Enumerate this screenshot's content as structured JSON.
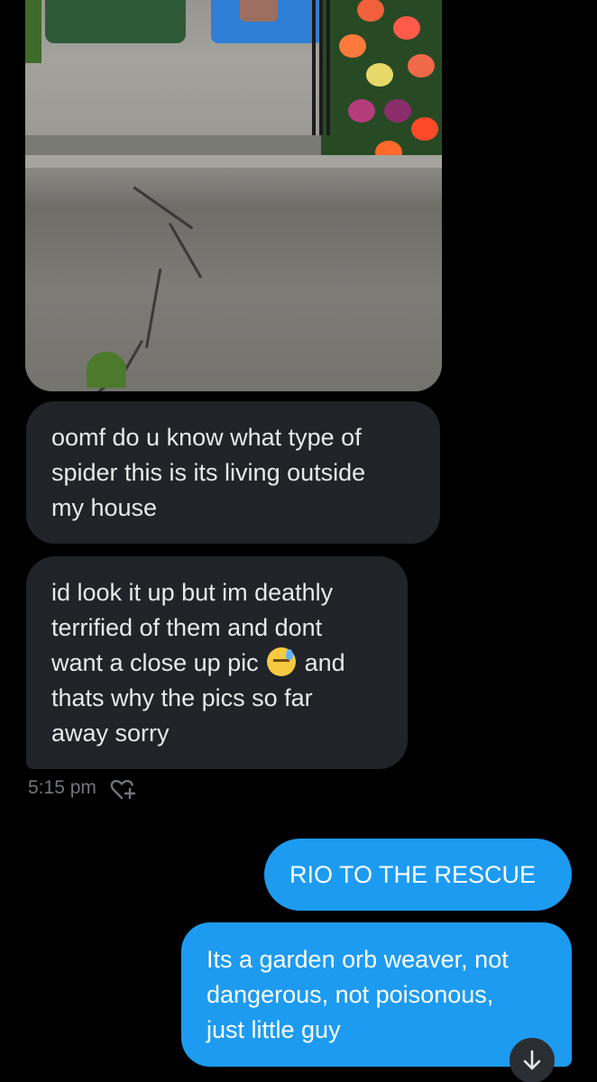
{
  "conversation": {
    "messages": [
      {
        "direction": "received",
        "text": "oomf do u know what type of\nspider this is its living outside\nmy house"
      },
      {
        "direction": "received",
        "text_before_emoji": "id look it up but im deathly\nterrified of them and dont\nwant a close up pic ",
        "emoji": "downcast-face-with-sweat",
        "text_after_emoji": " and\nthats why the pics so far\naway sorry"
      },
      {
        "direction": "sent",
        "text": "RIO TO THE RESCUE"
      },
      {
        "direction": "sent",
        "text": "Its a garden orb weaver, not\ndangerous, not poisonous,\njust  little guy"
      }
    ],
    "received_timestamp": "5:15 pm",
    "icons": {
      "reaction": "add-reaction-icon",
      "scroll": "arrow-down-icon"
    }
  },
  "colors": {
    "background": "#000000",
    "received_bubble": "#202327",
    "sent_bubble": "#1d9bf0",
    "timestamp": "#71767b"
  }
}
